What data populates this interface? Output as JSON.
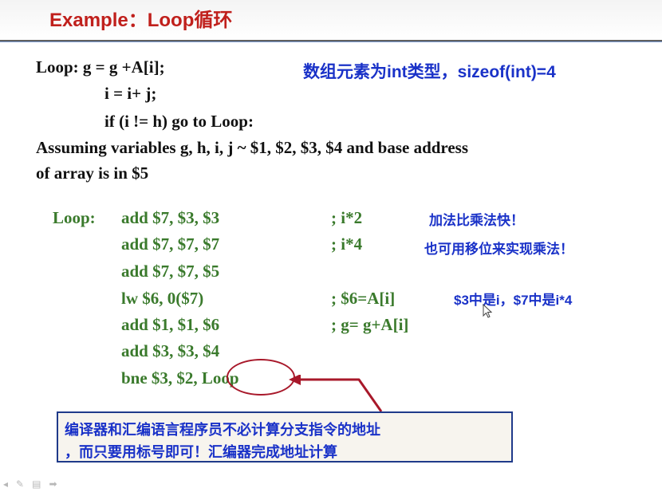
{
  "slide": {
    "title": "Example：Loop循环",
    "pseudo": {
      "line1": "Loop:  g = g +A[i];",
      "line2": "i = i+ j;",
      "line3": "if (i != h) go to Loop:",
      "line4": "Assuming variables g, h, i, j  ~ $1, $2, $3, $4 and base address",
      "line5": "of array is in $5"
    },
    "type_note": "数组元素为int类型，sizeof(int)=4",
    "assembly": {
      "label": "Loop:",
      "lines": [
        {
          "code": "add $7, $3, $3",
          "comment": "; i*2"
        },
        {
          "code": "add $7, $7, $7",
          "comment": "; i*4"
        },
        {
          "code": "add $7, $7, $5",
          "comment": ""
        },
        {
          "code": "lw $6, 0($7)",
          "comment": "; $6=A[i]"
        },
        {
          "code": "add $1, $1, $6",
          "comment": "; g= g+A[i]"
        },
        {
          "code": "add $3, $3, $4",
          "comment": ""
        },
        {
          "code": "bne $3, $2, Loop",
          "comment": ""
        }
      ]
    },
    "notes": {
      "add_faster": "加法比乘法快！",
      "shift_mult": "也可用移位来实现乘法！",
      "reg_meaning": "$3中是i，$7中是i*4"
    },
    "callout": {
      "line1": "编译器和汇编语言程序员不必计算分支指令的地址",
      "line2": "，而只要用标号即可！汇编器完成地址计算"
    }
  },
  "colors": {
    "title": "#c0201c",
    "code": "#3a7a2c",
    "note": "#1a32c8",
    "circle": "#a8182a"
  }
}
